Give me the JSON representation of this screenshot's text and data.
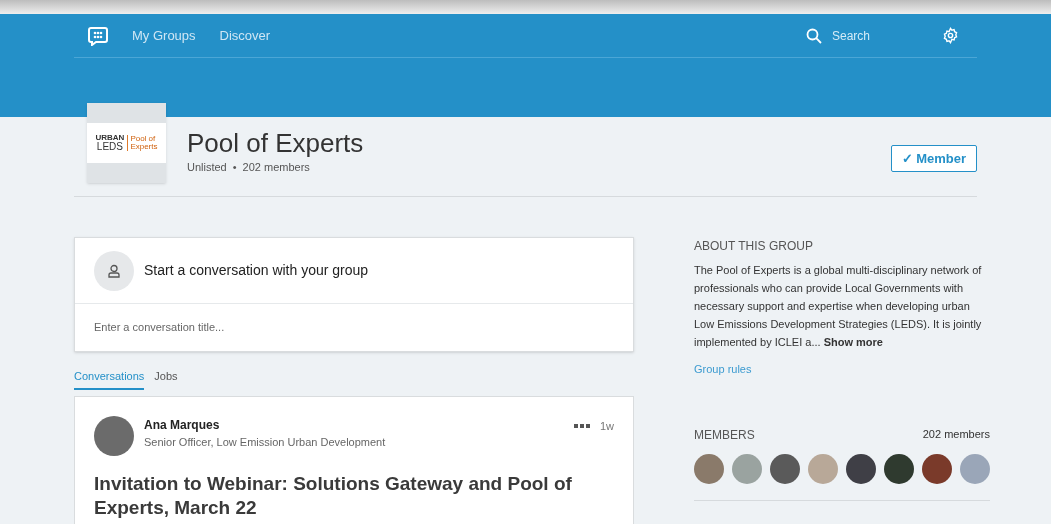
{
  "nav": {
    "links": [
      {
        "label": "My Groups"
      },
      {
        "label": "Discover"
      }
    ],
    "search": {
      "placeholder": "Search"
    }
  },
  "group": {
    "logo": {
      "line_1": "URBAN",
      "line_2": "LEDS",
      "side_1": "Pool of",
      "side_2": "Experts"
    },
    "name": "Pool of Experts",
    "visibility": "Unlisted",
    "separator": "•",
    "member_count": "202 members",
    "member_button": {
      "icon": "✓",
      "label": "Member",
      "selected": true
    }
  },
  "composer": {
    "prompt": "Start a conversation with your group",
    "placeholder": "Enter a conversation title..."
  },
  "tabs": [
    {
      "label": "Conversations",
      "selected": true
    },
    {
      "label": "Jobs",
      "selected": false
    }
  ],
  "post": {
    "author": "Ana Marques",
    "headline": "Senior Officer, Low Emission Urban Development",
    "time": "1w",
    "title": "Invitation to Webinar: Solutions Gateway and Pool of Experts, March 22"
  },
  "about": {
    "heading": "ABOUT THIS GROUP",
    "text": "The Pool of Experts is a global multi-disciplinary network of professionals who can provide Local Governments with necessary support and expertise when developing urban Low Emissions Development Strategies (LEDS). It is jointly implemented by ICLEI a...",
    "show_more": "Show more",
    "rules_link": "Group rules"
  },
  "members": {
    "heading": "MEMBERS",
    "count": "202 members"
  }
}
